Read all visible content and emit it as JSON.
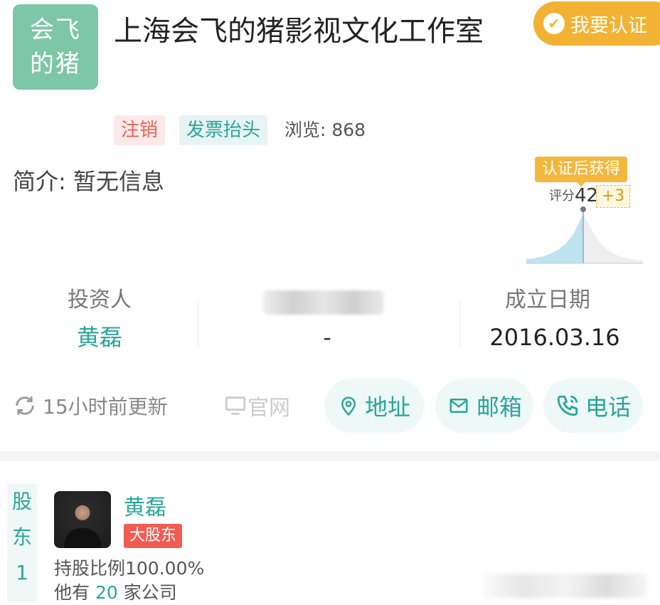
{
  "header": {
    "logo_text_line1": "会飞",
    "logo_text_line2": "的猪",
    "company_name": "上海会飞的猪影视文化工作室",
    "certify_button": "我要认证"
  },
  "tags": {
    "status": "注销",
    "invoice": "发票抬头",
    "views_label": "浏览: 868"
  },
  "intro": "简介: 暂无信息",
  "score": {
    "badge": "认证后获得",
    "label": "评分",
    "value": "42",
    "plus": "+3"
  },
  "stats": {
    "investor_label": "投资人",
    "investor_value": "黄磊",
    "middle_value": "-",
    "date_label": "成立日期",
    "date_value": "2016.03.16"
  },
  "actions": {
    "updated": "15小时前更新",
    "website": "官网",
    "address": "地址",
    "email": "邮箱",
    "phone": "电话"
  },
  "shareholder": {
    "side_1": "股",
    "side_2": "东",
    "side_3": "1",
    "name": "黄磊",
    "badge": "大股东",
    "ratio": "持股比例100.00%",
    "companies_prefix": "他有 ",
    "companies_count": "20",
    "companies_suffix": " 家公司"
  },
  "colors": {
    "accent": "#2aa59a",
    "logo": "#7dc6a6",
    "certify": "#f2b233",
    "danger": "#e0665d"
  }
}
